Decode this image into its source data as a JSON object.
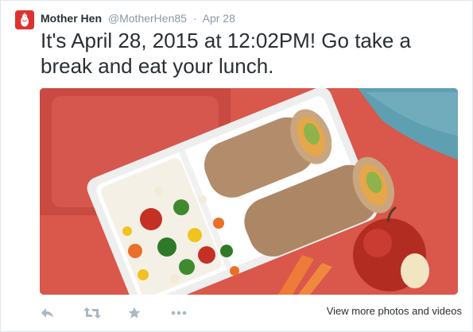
{
  "tweet": {
    "author_name": "Mother Hen",
    "handle": "@MotherHen85",
    "separator": "·",
    "date": "Apr 28",
    "text": "It's April 28, 2015 at 12:02PM! Go take a break and eat your lunch."
  },
  "media": {
    "type": "photo",
    "subject": "lunch box with tortilla wraps, vegetable salad and an apple"
  },
  "actions": {
    "reply_icon": "reply-icon",
    "retweet_icon": "retweet-icon",
    "favorite_icon": "star-icon",
    "more_icon": "more-icon",
    "view_more_label": "View more photos and videos"
  },
  "colors": {
    "avatar_bg": "#e0312f",
    "text": "#292f33",
    "muted": "#8899a6",
    "action_icon": "#aab8c2"
  }
}
